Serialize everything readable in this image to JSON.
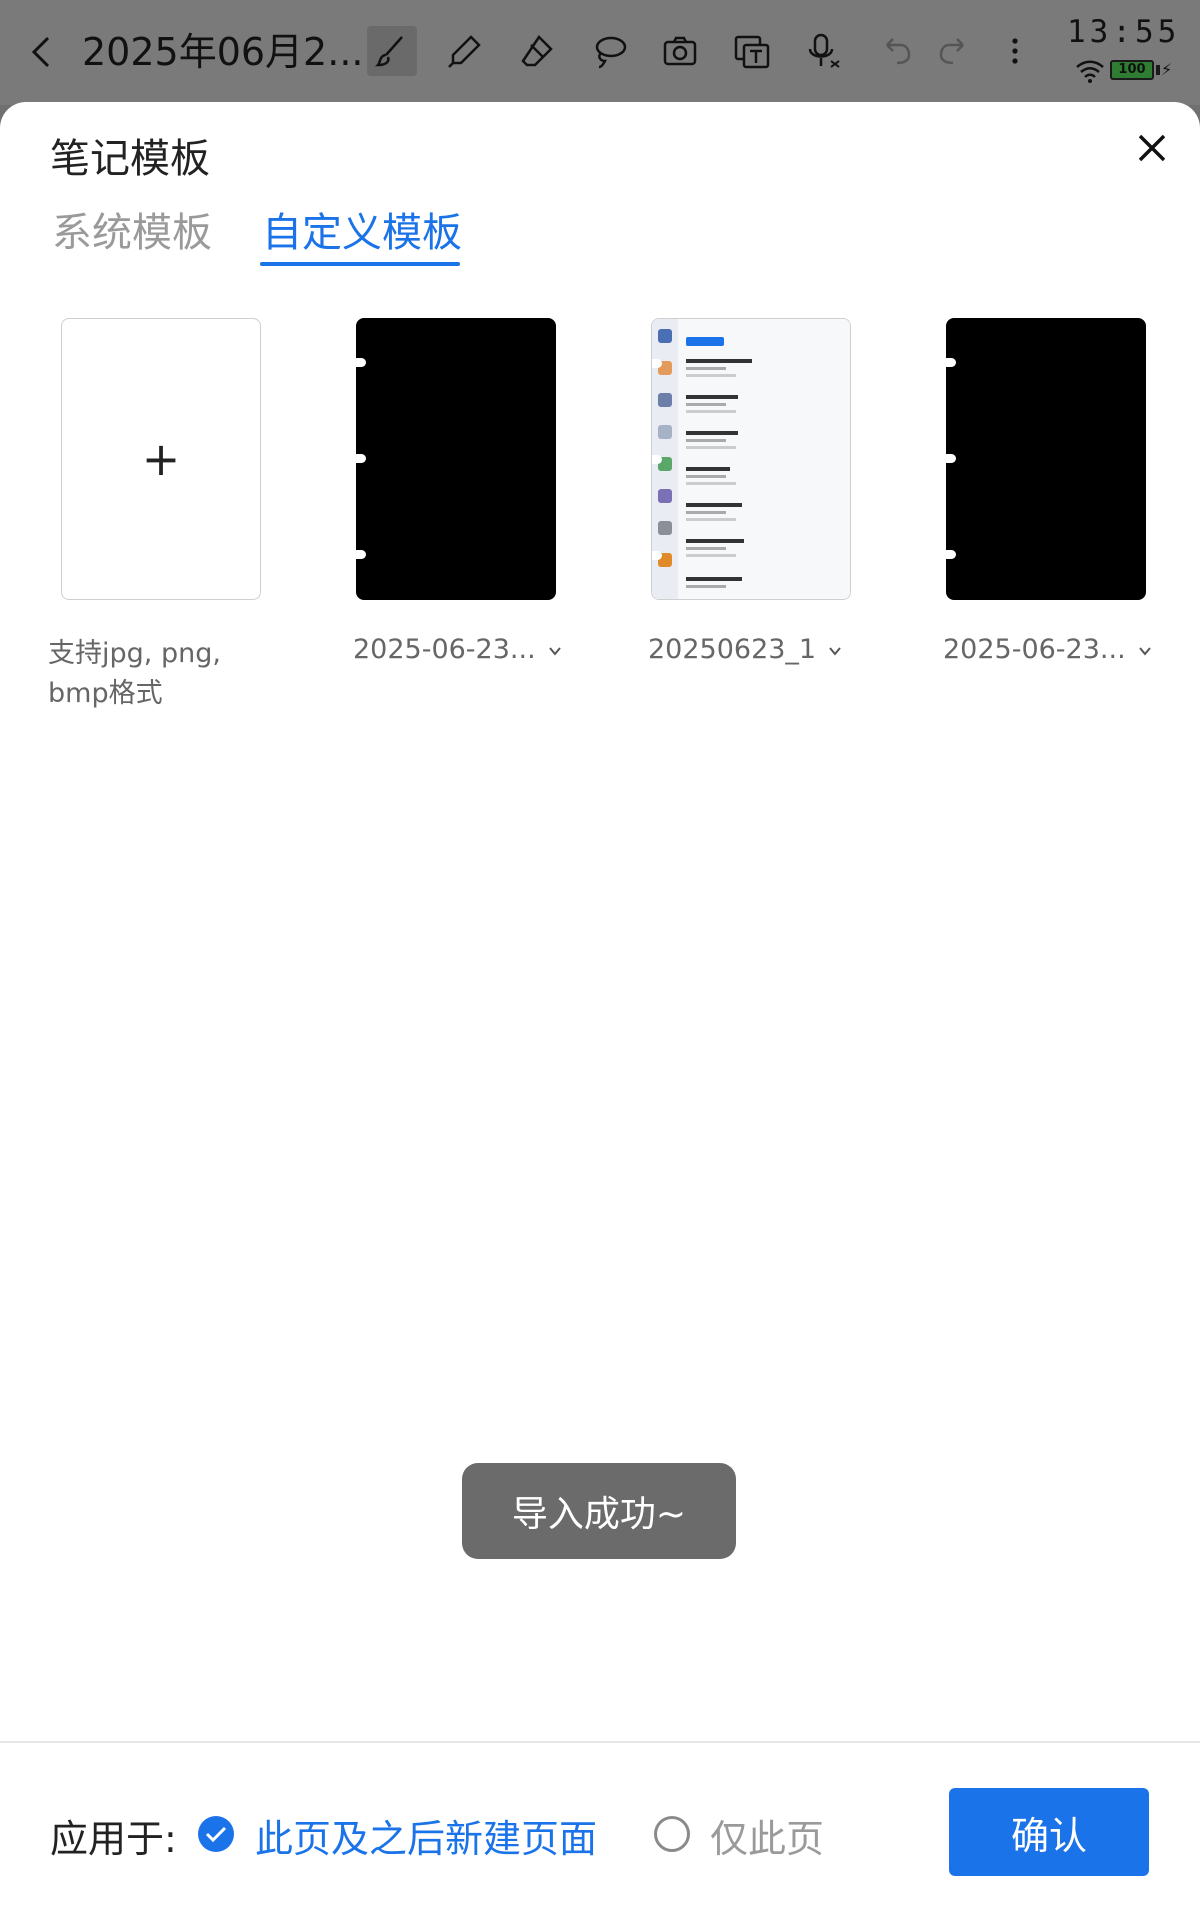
{
  "toolbar": {
    "title": "2025年06月2...",
    "tools": [
      "brush-icon",
      "marker-icon",
      "eraser-icon",
      "lasso-icon",
      "camera-icon",
      "text-recognition-icon",
      "voice-input-icon",
      "undo-icon",
      "redo-icon",
      "more-icon"
    ]
  },
  "status": {
    "time": "13:55",
    "battery": "100"
  },
  "sheet": {
    "title": "笔记模板",
    "tabs": {
      "system": "系统模板",
      "custom": "自定义模板",
      "active": "custom"
    },
    "upload_hint": "支持jpg, png, bmp格式",
    "templates": [
      {
        "label": "2025-06-23..."
      },
      {
        "label": "20250623_1"
      },
      {
        "label": "2025-06-23..."
      }
    ],
    "toast": "导入成功~",
    "apply": {
      "label": "应用于:",
      "option_all": "此页及之后新建页面",
      "option_this": "仅此页",
      "selected": "option_all"
    },
    "confirm": "确认"
  },
  "colors": {
    "accent": "#1a73e8",
    "toast_bg": "#6b6b6b",
    "scrim": "#7a7a7a"
  }
}
